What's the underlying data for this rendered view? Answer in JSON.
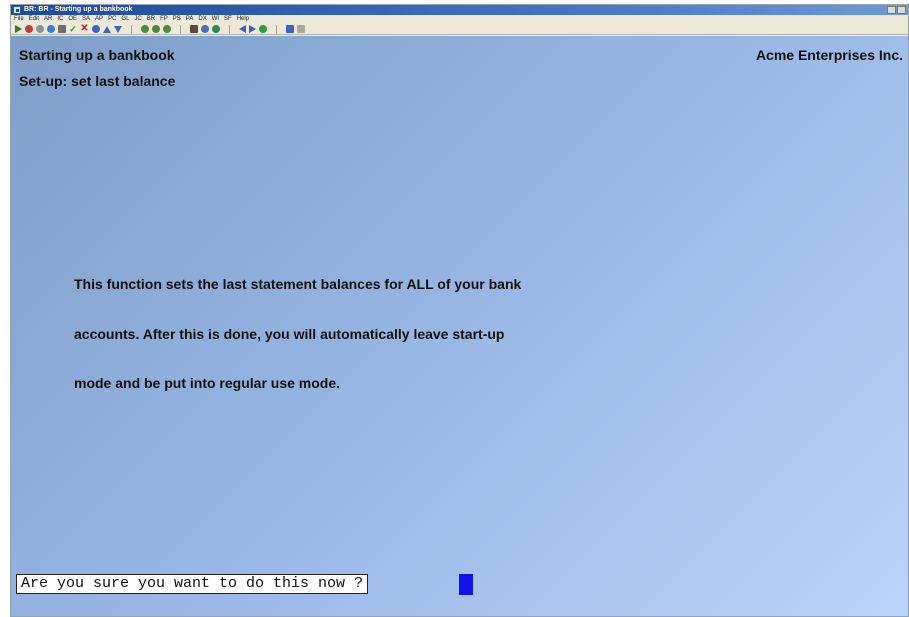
{
  "window": {
    "title": "BR: BR - Starting up a bankbook"
  },
  "menubar": {
    "items": [
      "File",
      "Edit",
      "AR",
      "IC",
      "OE",
      "SA",
      "AP",
      "PC",
      "GL",
      "JC",
      "BR",
      "FP",
      "PS",
      "PA",
      "DX",
      "WI",
      "SF",
      "Help"
    ]
  },
  "toolbar": {
    "icons": [
      "go-icon",
      "stop-icon",
      "tools-icon",
      "globe-icon",
      "print-icon",
      "check-icon",
      "cancel-icon",
      "undo-icon",
      "up-icon",
      "down-icon",
      "circle-icon",
      "circle-icon",
      "circle-icon",
      "find-icon",
      "zoom-icon",
      "refresh-icon",
      "prev-icon",
      "next-icon",
      "record-icon",
      "save-icon",
      "copy-icon"
    ]
  },
  "screen": {
    "header": "Starting up a bankbook",
    "company": "Acme Enterprises Inc.",
    "subheader": "Set-up: set last balance",
    "description": [
      "This function sets the last statement balances for ALL of your bank",
      "accounts.  After this is done, you will automatically leave start-up",
      "mode and be put into regular use mode."
    ],
    "prompt": "Are you sure you want to do this now ?"
  },
  "colors": {
    "screen_bg": "#96b4e2",
    "cursor": "#1212f0",
    "titlebar": "#1a4a9c"
  }
}
